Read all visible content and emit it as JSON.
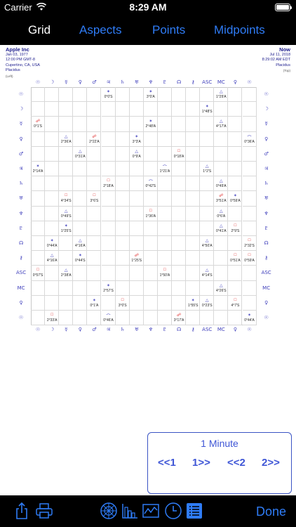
{
  "status_bar": {
    "carrier": "Carrier",
    "time": "8:29 AM"
  },
  "tabs": [
    {
      "label": "Grid",
      "active": true
    },
    {
      "label": "Aspects",
      "active": false
    },
    {
      "label": "Points",
      "active": false
    },
    {
      "label": "Midpoints",
      "active": false
    }
  ],
  "chart_left": {
    "name": "Apple Inc",
    "date": "Jan 03, 1977",
    "time": "12:00 PM GMT-8",
    "place": "Cupertino, CA, USA",
    "house_system": "Placidus",
    "note": "(Left)"
  },
  "chart_right": {
    "name": "Now",
    "date": "Jul 11, 2018",
    "time": "8:29:02 AM EDT",
    "house_system": "Placidus",
    "note": "(Top)"
  },
  "planet_glyphs": [
    "☉",
    "☽",
    "☿",
    "♀",
    "♂",
    "♃",
    "♄",
    "♅",
    "♆",
    "♇",
    "☊",
    "⚷",
    "ASC",
    "MC",
    "♀"
  ],
  "aspects": [
    {
      "row": 0,
      "col": 5,
      "sym": "✶",
      "val": "0°0'S",
      "color": "#3d3dbb"
    },
    {
      "row": 0,
      "col": 8,
      "sym": "✶",
      "val": "3°0'A",
      "color": "#3d3dbb"
    },
    {
      "row": 0,
      "col": 13,
      "sym": "△",
      "val": "1°29'A",
      "color": "#3d3dbb"
    },
    {
      "row": 1,
      "col": 12,
      "sym": "✶",
      "val": "1°48'S",
      "color": "#3d3dbb"
    },
    {
      "row": 2,
      "col": 0,
      "sym": "☍",
      "val": "0°1'S",
      "color": "#d22"
    },
    {
      "row": 2,
      "col": 8,
      "sym": "✶",
      "val": "2°48'A",
      "color": "#3d3dbb"
    },
    {
      "row": 2,
      "col": 13,
      "sym": "△",
      "val": "4°17'A",
      "color": "#3d3dbb"
    },
    {
      "row": 3,
      "col": 2,
      "sym": "△",
      "val": "2°36'A",
      "color": "#3d3dbb"
    },
    {
      "row": 3,
      "col": 4,
      "sym": "☍",
      "val": "2°22'A",
      "color": "#d22"
    },
    {
      "row": 3,
      "col": 7,
      "sym": "✶",
      "val": "3°3'A",
      "color": "#3d3dbb"
    },
    {
      "row": 3,
      "col": 15,
      "sym": "⌒",
      "val": "0°36'A",
      "color": "#3d3dbb"
    },
    {
      "row": 4,
      "col": 3,
      "sym": "△",
      "val": "0°31'A",
      "color": "#3d3dbb"
    },
    {
      "row": 4,
      "col": 7,
      "sym": "△",
      "val": "0°9'A",
      "color": "#3d3dbb"
    },
    {
      "row": 4,
      "col": 10,
      "sym": "□",
      "val": "0°18'A",
      "color": "#d22"
    },
    {
      "row": 5,
      "col": 0,
      "sym": "✶",
      "val": "2°14'A",
      "color": "#3d3dbb"
    },
    {
      "row": 5,
      "col": 9,
      "sym": "⌒",
      "val": "1°21'A",
      "color": "#3d3dbb"
    },
    {
      "row": 5,
      "col": 12,
      "sym": "△",
      "val": "1°2'S",
      "color": "#3d3dbb"
    },
    {
      "row": 6,
      "col": 5,
      "sym": "□",
      "val": "2°18'A",
      "color": "#d22"
    },
    {
      "row": 6,
      "col": 8,
      "sym": "⌒",
      "val": "0°42'S",
      "color": "#3d3dbb"
    },
    {
      "row": 6,
      "col": 13,
      "sym": "△",
      "val": "0°49'A",
      "color": "#3d3dbb"
    },
    {
      "row": 7,
      "col": 2,
      "sym": "□",
      "val": "4°34'S",
      "color": "#d22"
    },
    {
      "row": 7,
      "col": 4,
      "sym": "□",
      "val": "3°6'S",
      "color": "#d22"
    },
    {
      "row": 7,
      "col": 13,
      "sym": "☍",
      "val": "3°51'A",
      "color": "#d22"
    },
    {
      "row": 7,
      "col": 14,
      "sym": "✶",
      "val": "0°59'A",
      "color": "#3d3dbb"
    },
    {
      "row": 8,
      "col": 2,
      "sym": "△",
      "val": "0°49'S",
      "color": "#3d3dbb"
    },
    {
      "row": 8,
      "col": 8,
      "sym": "□",
      "val": "1°36'A",
      "color": "#d22"
    },
    {
      "row": 8,
      "col": 13,
      "sym": "△",
      "val": "0°6'A",
      "color": "#3d3dbb"
    },
    {
      "row": 9,
      "col": 2,
      "sym": "✶",
      "val": "1°25'S",
      "color": "#3d3dbb"
    },
    {
      "row": 9,
      "col": 13,
      "sym": "△",
      "val": "0°41'A",
      "color": "#3d3dbb"
    },
    {
      "row": 9,
      "col": 14,
      "sym": "□",
      "val": "2°9'S",
      "color": "#d22"
    },
    {
      "row": 10,
      "col": 1,
      "sym": "✶",
      "val": "0°44'A",
      "color": "#3d3dbb"
    },
    {
      "row": 10,
      "col": 3,
      "sym": "△",
      "val": "4°16'A",
      "color": "#3d3dbb"
    },
    {
      "row": 10,
      "col": 12,
      "sym": "△",
      "val": "4°50'A",
      "color": "#3d3dbb"
    },
    {
      "row": 10,
      "col": 15,
      "sym": "□",
      "val": "2°32'S",
      "color": "#d22"
    },
    {
      "row": 11,
      "col": 1,
      "sym": "△",
      "val": "4°16'A",
      "color": "#3d3dbb"
    },
    {
      "row": 11,
      "col": 3,
      "sym": "✶",
      "val": "0°44'S",
      "color": "#3d3dbb"
    },
    {
      "row": 11,
      "col": 7,
      "sym": "☍",
      "val": "1°25'S",
      "color": "#d22"
    },
    {
      "row": 11,
      "col": 14,
      "sym": "□",
      "val": "0°51'A",
      "color": "#d22"
    },
    {
      "row": 11,
      "col": 15,
      "sym": "□",
      "val": "0°59'A",
      "color": "#d22"
    },
    {
      "row": 12,
      "col": 0,
      "sym": "□",
      "val": "0°57'S",
      "color": "#d22"
    },
    {
      "row": 12,
      "col": 2,
      "sym": "△",
      "val": "2°38'A",
      "color": "#3d3dbb"
    },
    {
      "row": 12,
      "col": 9,
      "sym": "□",
      "val": "1°50'A",
      "color": "#d22"
    },
    {
      "row": 12,
      "col": 12,
      "sym": "△",
      "val": "4°14'S",
      "color": "#3d3dbb"
    },
    {
      "row": 13,
      "col": 5,
      "sym": "✶",
      "val": "2°57'S",
      "color": "#3d3dbb"
    },
    {
      "row": 13,
      "col": 13,
      "sym": "△",
      "val": "4°26'S",
      "color": "#3d3dbb"
    },
    {
      "row": 14,
      "col": 4,
      "sym": "✶",
      "val": "0°1'A",
      "color": "#3d3dbb"
    },
    {
      "row": 14,
      "col": 6,
      "sym": "□",
      "val": "3°0'S",
      "color": "#d22"
    },
    {
      "row": 14,
      "col": 11,
      "sym": "✶",
      "val": "1°55'S",
      "color": "#3d3dbb"
    },
    {
      "row": 14,
      "col": 12,
      "sym": "△",
      "val": "0°23'S",
      "color": "#3d3dbb"
    },
    {
      "row": 14,
      "col": 14,
      "sym": "□",
      "val": "4°7'S",
      "color": "#d22"
    },
    {
      "row": 15,
      "col": 1,
      "sym": "□",
      "val": "2°33'A",
      "color": "#d22"
    },
    {
      "row": 15,
      "col": 5,
      "sym": "⌒",
      "val": "0°46'A",
      "color": "#3d3dbb"
    },
    {
      "row": 15,
      "col": 10,
      "sym": "☍",
      "val": "3°17'A",
      "color": "#d22"
    },
    {
      "row": 15,
      "col": 15,
      "sym": "✶",
      "val": "0°44'A",
      "color": "#3d3dbb"
    }
  ],
  "controls": {
    "step_label": "1 Minute",
    "back1": "<<1",
    "fwd1": "1>>",
    "back2": "<<2",
    "fwd2": "2>>"
  },
  "toolbar": {
    "icons": [
      "share-icon",
      "print-icon",
      "wheel-icon",
      "bar-chart-icon",
      "line-graph-icon",
      "clock-icon",
      "list-icon"
    ],
    "done_label": "Done",
    "accent": "#2f7cf6"
  }
}
